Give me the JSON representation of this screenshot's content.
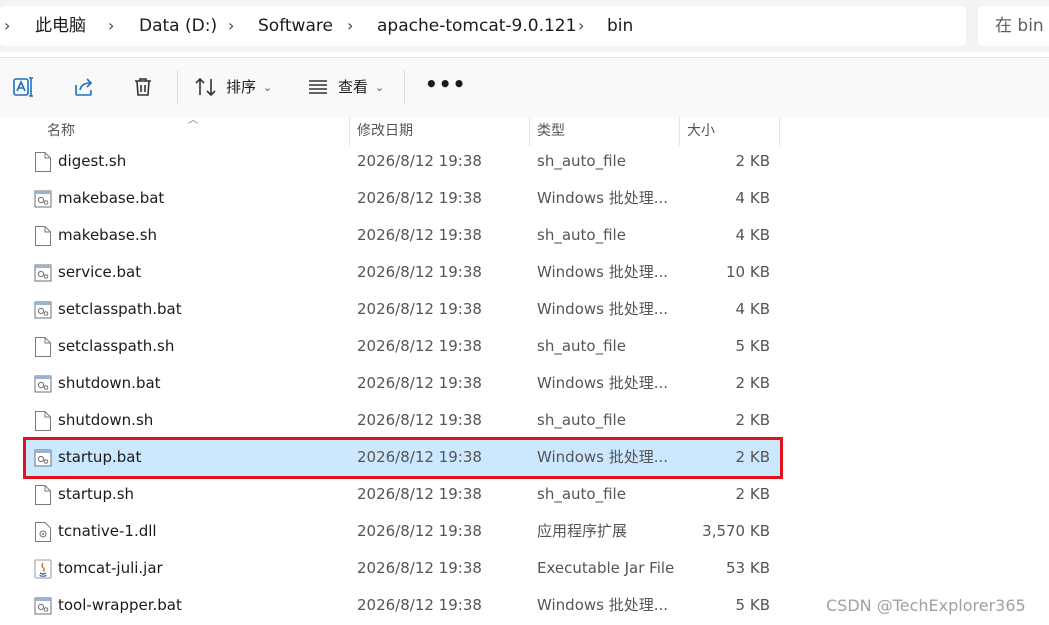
{
  "breadcrumb": [
    "此电脑",
    "Data (D:)",
    "Software",
    "apache-tomcat-9.0.121",
    "bin"
  ],
  "search": {
    "placeholder": "在 bin 中搜索",
    "visible_text": "在 bin"
  },
  "toolbar": {
    "sort_label": "排序",
    "view_label": "查看",
    "more_label": "•••"
  },
  "columns": {
    "name": "名称",
    "date": "修改日期",
    "type": "类型",
    "size": "大小"
  },
  "files": [
    {
      "name": "digest.sh",
      "date": "2026/8/12 19:38",
      "type": "sh_auto_file",
      "size": "2 KB",
      "icon": "blank-file-icon"
    },
    {
      "name": "makebase.bat",
      "date": "2026/8/12 19:38",
      "type": "Windows 批处理...",
      "size": "4 KB",
      "icon": "batch-file-icon"
    },
    {
      "name": "makebase.sh",
      "date": "2026/8/12 19:38",
      "type": "sh_auto_file",
      "size": "4 KB",
      "icon": "blank-file-icon"
    },
    {
      "name": "service.bat",
      "date": "2026/8/12 19:38",
      "type": "Windows 批处理...",
      "size": "10 KB",
      "icon": "batch-file-icon"
    },
    {
      "name": "setclasspath.bat",
      "date": "2026/8/12 19:38",
      "type": "Windows 批处理...",
      "size": "4 KB",
      "icon": "batch-file-icon"
    },
    {
      "name": "setclasspath.sh",
      "date": "2026/8/12 19:38",
      "type": "sh_auto_file",
      "size": "5 KB",
      "icon": "blank-file-icon"
    },
    {
      "name": "shutdown.bat",
      "date": "2026/8/12 19:38",
      "type": "Windows 批处理...",
      "size": "2 KB",
      "icon": "batch-file-icon"
    },
    {
      "name": "shutdown.sh",
      "date": "2026/8/12 19:38",
      "type": "sh_auto_file",
      "size": "2 KB",
      "icon": "blank-file-icon"
    },
    {
      "name": "startup.bat",
      "date": "2026/8/12 19:38",
      "type": "Windows 批处理...",
      "size": "2 KB",
      "icon": "batch-file-icon",
      "selected": true
    },
    {
      "name": "startup.sh",
      "date": "2026/8/12 19:38",
      "type": "sh_auto_file",
      "size": "2 KB",
      "icon": "blank-file-icon"
    },
    {
      "name": "tcnative-1.dll",
      "date": "2026/8/12 19:38",
      "type": "应用程序扩展",
      "size": "3,570 KB",
      "icon": "dll-file-icon"
    },
    {
      "name": "tomcat-juli.jar",
      "date": "2026/8/12 19:38",
      "type": "Executable Jar File",
      "size": "53 KB",
      "icon": "java-jar-icon"
    },
    {
      "name": "tool-wrapper.bat",
      "date": "2026/8/12 19:38",
      "type": "Windows 批处理...",
      "size": "5 KB",
      "icon": "batch-file-icon"
    }
  ],
  "watermark": "CSDN @TechExplorer365",
  "colors": {
    "selection": "#cce8ff",
    "highlight_border": "#e3121f"
  }
}
